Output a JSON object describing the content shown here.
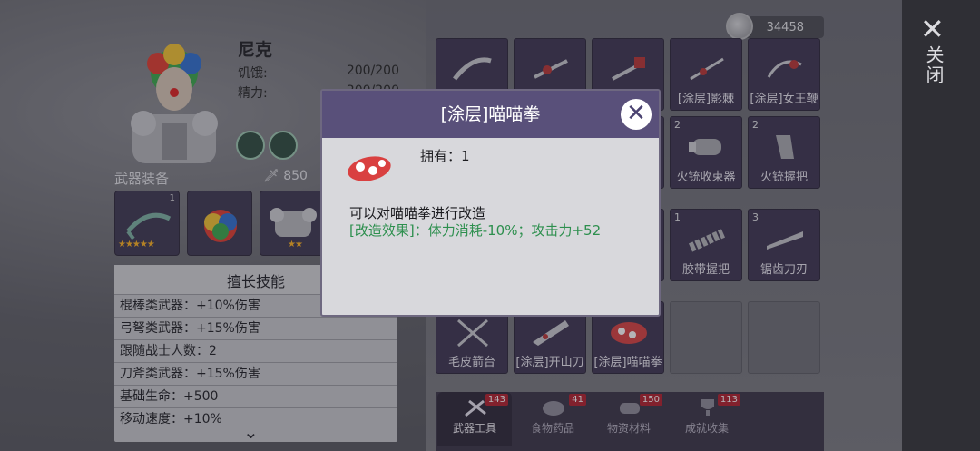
{
  "currency": {
    "amount": "34458"
  },
  "close": {
    "label": "关闭"
  },
  "character": {
    "name": "尼克",
    "stats": [
      {
        "label": "饥饿:",
        "value": "200/200"
      },
      {
        "label": "精力:",
        "value": "200/200"
      }
    ]
  },
  "equipment": {
    "title": "武器装备",
    "power": "850",
    "weapon_level": "1",
    "weapon_stars": "★★★★★",
    "armor_stars": "★★"
  },
  "skills": {
    "title": "擅长技能",
    "rows": [
      "棍棒类武器：+10%伤害",
      "弓弩类武器：+15%伤害",
      "跟随战士人数：2",
      "刀斧类武器：+15%伤害",
      "基础生命：+500",
      "移动速度：+10%"
    ]
  },
  "inventory": {
    "row1": [
      {
        "label": "",
        "count": ""
      },
      {
        "label": "",
        "count": ""
      },
      {
        "label": "",
        "count": ""
      },
      {
        "label": "[涂层]影棘",
        "count": ""
      },
      {
        "label": "[涂层]女王鞭",
        "count": ""
      }
    ],
    "row2": [
      {
        "label": "",
        "count": ""
      },
      {
        "label": "",
        "count": ""
      },
      {
        "label": "",
        "count": ""
      },
      {
        "label": "火铳收束器",
        "count": "2"
      },
      {
        "label": "火铳握把",
        "count": "2"
      }
    ],
    "row3": [
      {
        "label": "",
        "count": ""
      },
      {
        "label": "",
        "count": ""
      },
      {
        "label": "",
        "count": ""
      },
      {
        "label": "胶带握把",
        "count": "1"
      },
      {
        "label": "锯齿刀刃",
        "count": "3"
      }
    ],
    "row4": [
      {
        "label": "毛皮箭台",
        "count": ""
      },
      {
        "label": "[涂层]开山刀",
        "count": ""
      },
      {
        "label": "[涂层]喵喵拳",
        "count": ""
      }
    ]
  },
  "tabs": [
    {
      "label": "武器工具",
      "badge": "143"
    },
    {
      "label": "食物药品",
      "badge": "41"
    },
    {
      "label": "物资材料",
      "badge": "150"
    },
    {
      "label": "成就收集",
      "badge": "113"
    }
  ],
  "dialog": {
    "title": "[涂层]喵喵拳",
    "owned": "拥有：1",
    "description": "可以对喵喵拳进行改造",
    "effect": "[改造效果]：体力消耗-10%；攻击力+52"
  }
}
